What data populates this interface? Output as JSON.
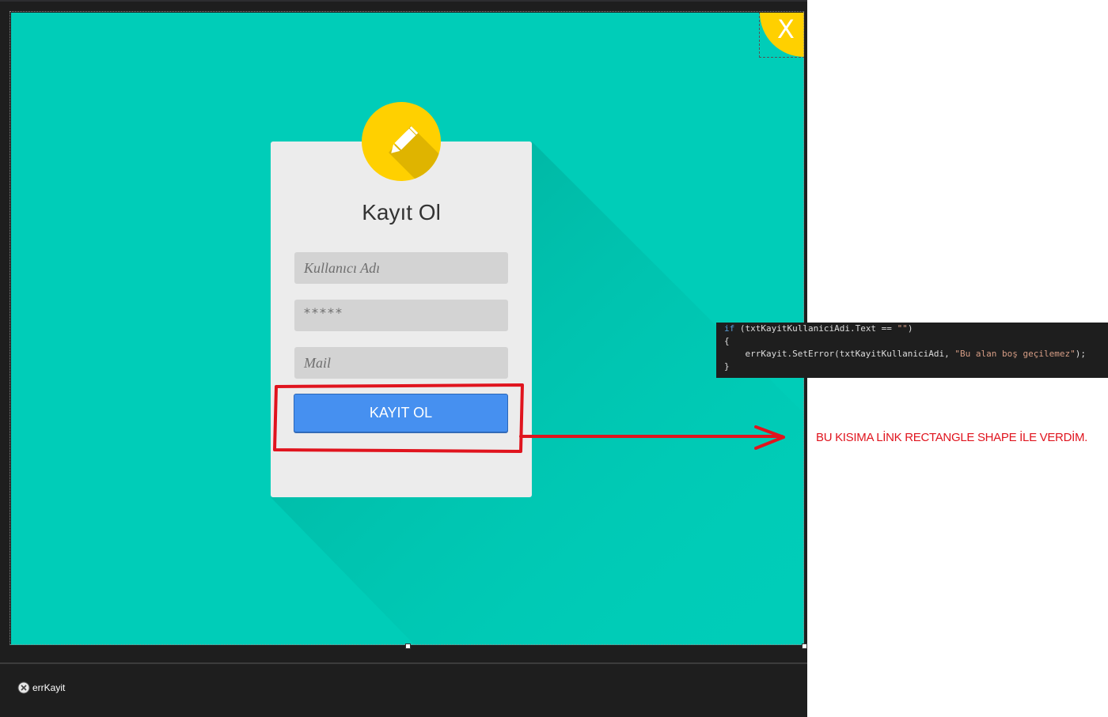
{
  "form": {
    "close_label": "X",
    "card_title": "Kayıt Ol",
    "username_placeholder": "Kullanıcı Adı",
    "password_value": "*****",
    "mail_placeholder": "Mail",
    "register_button": "KAYIT OL"
  },
  "tray": {
    "component_name": "errKayit"
  },
  "code": {
    "line1_kw": "if",
    "line1_rest": " (txtKayitKullaniciAdi.Text == ",
    "line1_str": "\"\"",
    "line1_end": ")",
    "line2": "{",
    "line3_pre": "    errKayit.SetError(txtKayitKullaniciAdi, ",
    "line3_str": "\"Bu alan boş geçilemez\"",
    "line3_end": ");",
    "line4": "}"
  },
  "annotation": {
    "note": "BU KISIMA LİNK RECTANGLE SHAPE İLE VERDİM."
  },
  "colors": {
    "form_background": "#00cdb8",
    "accent_yellow": "#ffd000",
    "button_blue": "#4690f0",
    "annotation_red": "#e0141e"
  }
}
